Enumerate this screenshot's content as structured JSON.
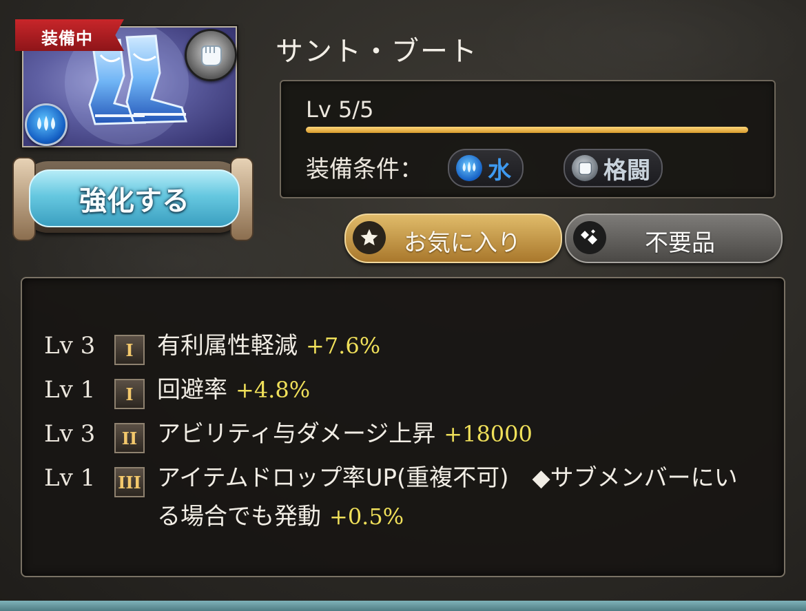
{
  "item": {
    "equipped_badge": "装備中",
    "name": "サント・ブート",
    "weapon_type_icon": "fist-icon",
    "element_icon": "water-drops-icon"
  },
  "enhance_button": {
    "label": "強化する"
  },
  "level": {
    "text": "Lv 5/5",
    "progress": 1.0,
    "bar_color": "#f0b84a"
  },
  "requirements": {
    "label": "装備条件：",
    "element": {
      "label": "水",
      "icon": "water-drops-icon",
      "color": "#2f86e6"
    },
    "weapon": {
      "label": "格闘",
      "icon": "fist-icon",
      "color": "#c9d3dc"
    }
  },
  "buttons": {
    "favorite": {
      "label": "お気に入り",
      "icon": "star-icon"
    },
    "junk": {
      "label": "不要品",
      "icon": "diamond-icon"
    }
  },
  "skills": [
    {
      "lv": "Lv 3",
      "tier": "I",
      "name": "有利属性軽減",
      "value": "+7.6%"
    },
    {
      "lv": "Lv 1",
      "tier": "I",
      "name": "回避率",
      "value": "+4.8%"
    },
    {
      "lv": "Lv 3",
      "tier": "II",
      "name": "アビリティ与ダメージ上昇",
      "value": "+18000"
    },
    {
      "lv": "Lv 1",
      "tier": "III",
      "name": "アイテムドロップ率UP(重複不可)　◆サブメンバーにいる場合でも発動",
      "value": "+0.5%"
    }
  ],
  "colors": {
    "value_text": "#f0e05a",
    "tier_text": "#f3c86c",
    "equipped_ribbon": "#b81f24"
  }
}
